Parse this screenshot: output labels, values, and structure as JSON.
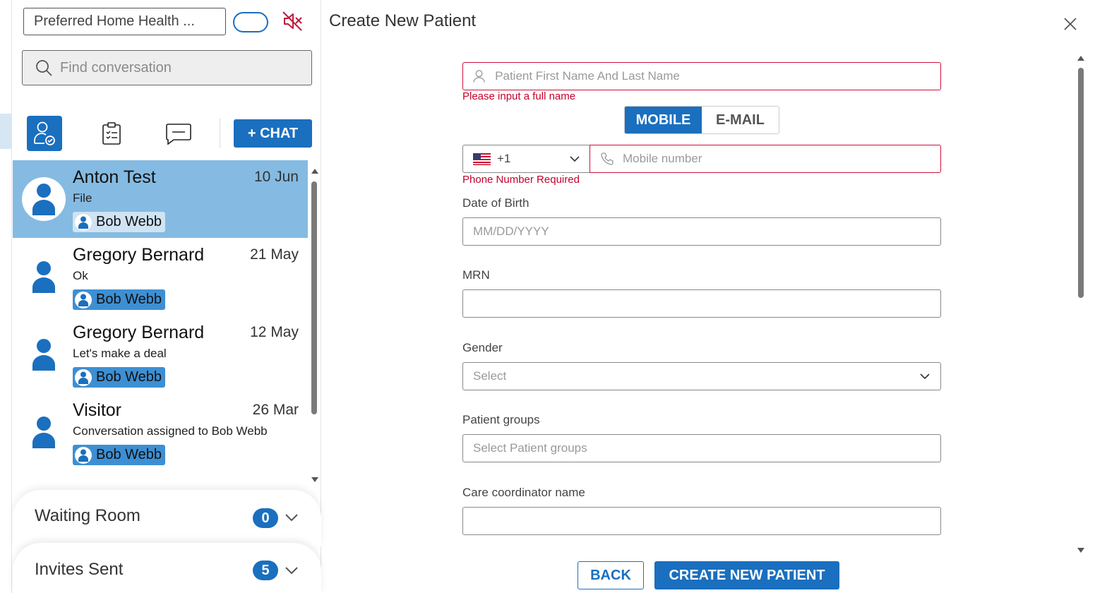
{
  "colors": {
    "accent": "#1a6fbf",
    "error": "#c4002b",
    "active_row": "#85bbe2"
  },
  "sidebar": {
    "org_name": "Preferred Home Health ...",
    "search_placeholder": "Find conversation",
    "chat_button": "+ CHAT",
    "conversations": [
      {
        "name": "Anton Test",
        "date": "10 Jun",
        "preview": "File",
        "assignee": "Bob Webb",
        "active": true
      },
      {
        "name": "Gregory Bernard",
        "date": "21 May",
        "preview": "Ok",
        "assignee": "Bob Webb",
        "active": false
      },
      {
        "name": "Gregory Bernard",
        "date": "12 May",
        "preview": "Let's make a deal",
        "assignee": "Bob Webb",
        "active": false
      },
      {
        "name": "Visitor",
        "date": "26 Mar",
        "preview": "Conversation assigned to Bob Webb",
        "assignee": "Bob Webb",
        "active": false
      }
    ],
    "waiting_room": {
      "label": "Waiting Room",
      "count": "0"
    },
    "invites_sent": {
      "label": "Invites Sent",
      "count": "5"
    }
  },
  "main": {
    "title": "Create New Patient",
    "name_placeholder": "Patient First Name And Last Name",
    "name_error": "Please input a full name",
    "contact_tabs": {
      "mobile": "MOBILE",
      "email": "E-MAIL",
      "selected": "MOBILE"
    },
    "country_code": "+1",
    "phone_placeholder": "Mobile number",
    "phone_error": "Phone Number Required",
    "dob_label": "Date of Birth",
    "dob_placeholder": "MM/DD/YYYY",
    "mrn_label": "MRN",
    "gender_label": "Gender",
    "gender_placeholder": "Select",
    "groups_label": "Patient groups",
    "groups_placeholder": "Select Patient groups",
    "coordinator_label": "Care coordinator name",
    "back_button": "BACK",
    "create_button": "CREATE NEW PATIENT"
  }
}
